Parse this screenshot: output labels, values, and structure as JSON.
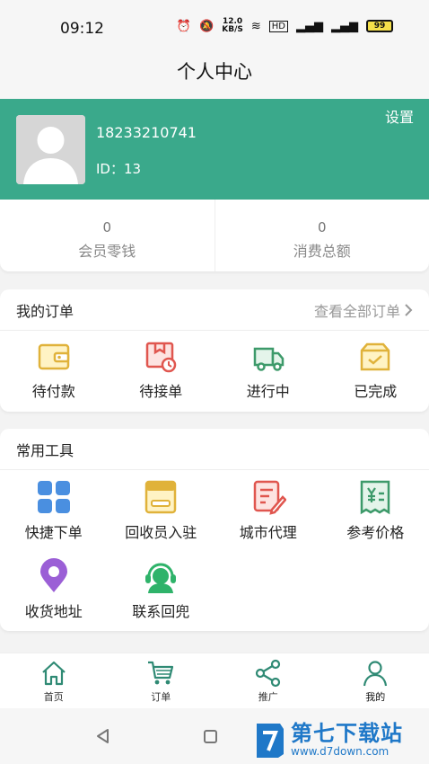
{
  "status_bar": {
    "time": "09:12",
    "speed_value": "12.0",
    "speed_unit": "KB/S",
    "battery": "99"
  },
  "header": {
    "title": "个人中心"
  },
  "profile": {
    "phone": "18233210741",
    "id_text": "ID：13",
    "settings_label": "设置"
  },
  "wallet": [
    {
      "value": "0",
      "label": "会员零钱"
    },
    {
      "value": "0",
      "label": "消费总额"
    }
  ],
  "orders": {
    "title": "我的订单",
    "view_all": "查看全部订单",
    "items": [
      {
        "label": "待付款",
        "icon": "wallet-icon"
      },
      {
        "label": "待接单",
        "icon": "package-clock-icon"
      },
      {
        "label": "进行中",
        "icon": "truck-icon"
      },
      {
        "label": "已完成",
        "icon": "box-check-icon"
      }
    ]
  },
  "tools": {
    "title": "常用工具",
    "items": [
      {
        "label": "快捷下单",
        "icon": "grid-icon"
      },
      {
        "label": "回收员入驻",
        "icon": "id-card-icon"
      },
      {
        "label": "城市代理",
        "icon": "document-edit-icon"
      },
      {
        "label": "参考价格",
        "icon": "receipt-yen-icon"
      },
      {
        "label": "收货地址",
        "icon": "location-pin-icon"
      },
      {
        "label": "联系回兜",
        "icon": "customer-service-icon"
      }
    ]
  },
  "bottom_nav": [
    {
      "label": "首页",
      "icon": "home-icon",
      "active": false
    },
    {
      "label": "订单",
      "icon": "cart-icon",
      "active": false
    },
    {
      "label": "推广",
      "icon": "share-icon",
      "active": false
    },
    {
      "label": "我的",
      "icon": "user-icon",
      "active": true
    }
  ],
  "watermark": {
    "title": "第七下载站",
    "subtitle": "www.d7down.com"
  },
  "colors": {
    "brand": "#3aa98b",
    "icon_yellow": "#e0b23a",
    "icon_red": "#e0564f",
    "icon_green": "#3d9a6a",
    "icon_blue": "#4a8fe0",
    "icon_purple": "#9b5fd6",
    "nav_green": "#2f8a74"
  }
}
